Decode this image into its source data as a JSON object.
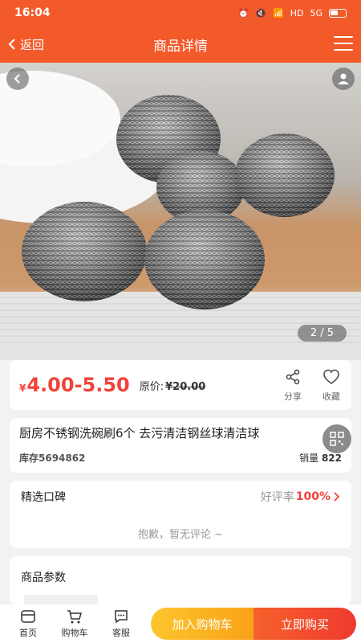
{
  "status_bar": {
    "time": "16:04",
    "network": "5G",
    "hd": "HD"
  },
  "nav": {
    "back_label": "返回",
    "title": "商品详情"
  },
  "gallery": {
    "counter": "2 / 5"
  },
  "price": {
    "currency": "¥",
    "value": "4.00-5.50",
    "original_label": "原价:",
    "original_value": "¥20.00"
  },
  "actions": {
    "share_label": "分享",
    "favorite_label": "收藏"
  },
  "product": {
    "title": "厨房不锈钢洗碗刷6个 去污清洁钢丝球清洁球",
    "stock": "库存5694862",
    "sales_label": "销量",
    "sales_value": "822"
  },
  "reviews": {
    "title": "精选口碑",
    "good_rate_label": "好评率",
    "good_rate_value": "100%",
    "empty_text": "抱歉，暂无评论 ~"
  },
  "params": {
    "title": "商品参数"
  },
  "bottom_nav": {
    "tabs": [
      {
        "label": "首页",
        "icon": "home-icon"
      },
      {
        "label": "购物车",
        "icon": "cart-icon"
      },
      {
        "label": "客服",
        "icon": "chat-icon"
      }
    ],
    "add_cart_label": "加入购物车",
    "buy_now_label": "立即购买"
  },
  "colors": {
    "brand": "#f25a2a",
    "price": "#f0433b",
    "cart_button": "#f9a219",
    "buy_button": "#ef3a2f"
  }
}
